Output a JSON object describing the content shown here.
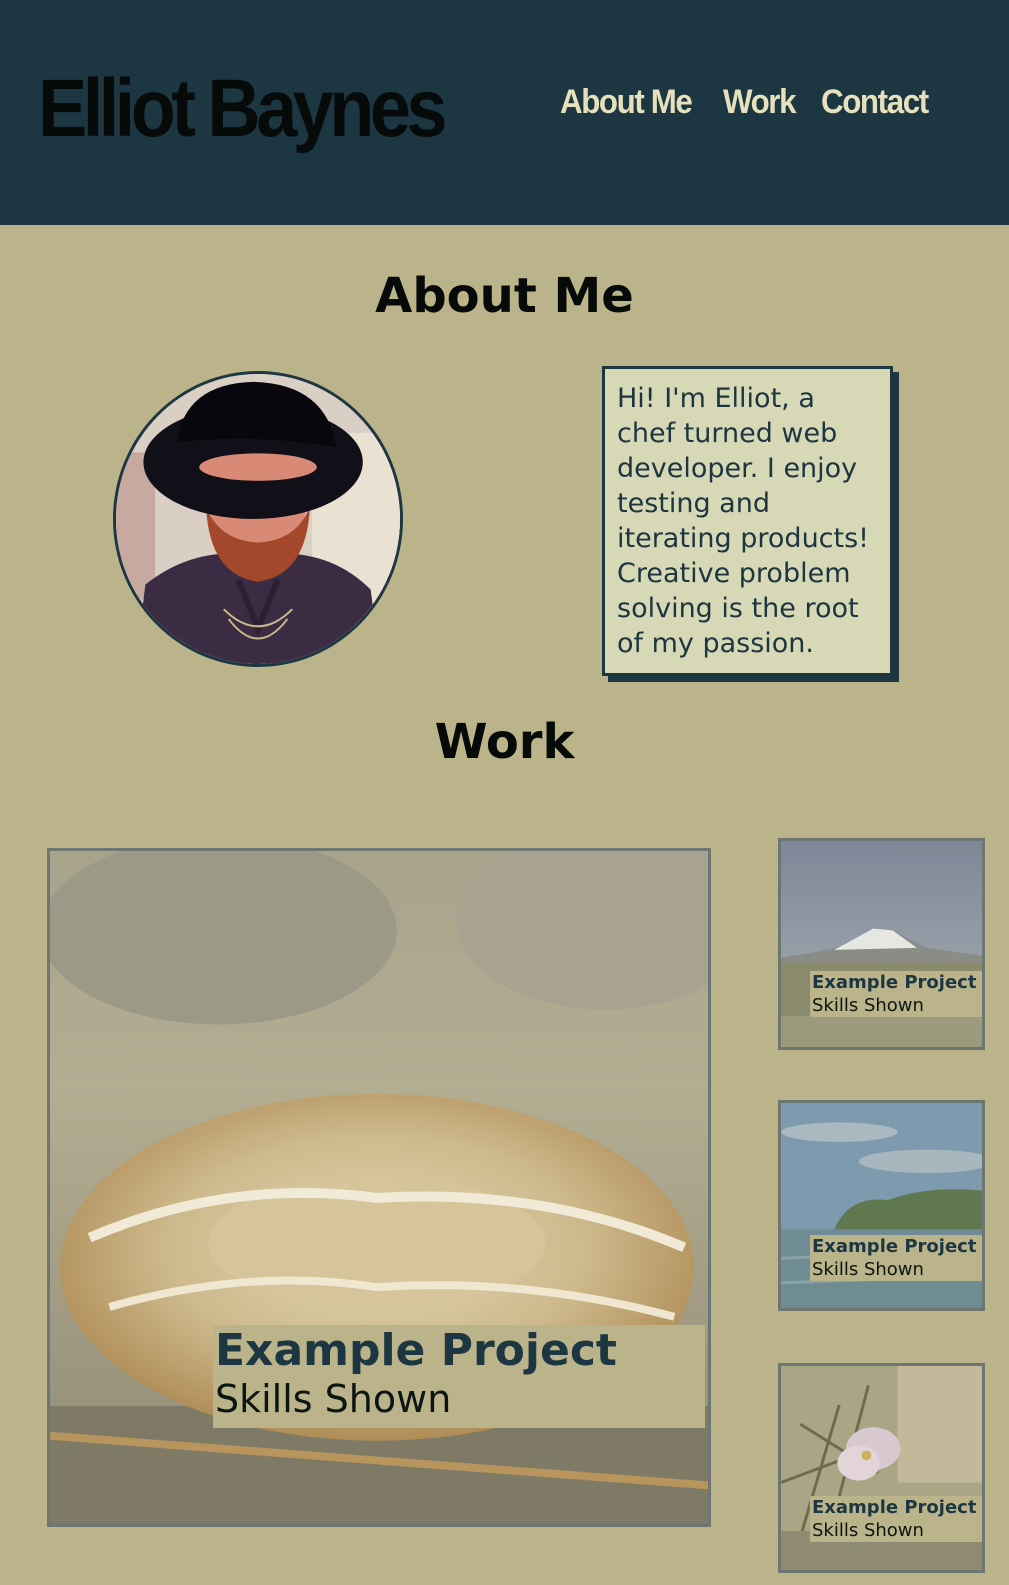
{
  "header": {
    "site_title": "Elliot Baynes",
    "nav": [
      "About Me",
      "Work",
      "Contact"
    ]
  },
  "about": {
    "heading": "About Me",
    "bio": "Hi! I'm Elliot, a chef turned web developer. I enjoy testing and iterating products! Creative problem solving is the root of my passion."
  },
  "work": {
    "heading": "Work",
    "featured": {
      "title": "Example Project",
      "skills": "Skills Shown"
    },
    "projects": [
      {
        "title": "Example Project",
        "skills": "Skills Shown"
      },
      {
        "title": "Example Project",
        "skills": "Skills Shown"
      },
      {
        "title": "Example Project",
        "skills": "Skills Shown"
      }
    ]
  },
  "colors": {
    "header_bg": "#1c3642",
    "page_bg": "#bbb48a",
    "nav_text": "#e6e0bd",
    "card_bg": "#d7d8b6"
  }
}
